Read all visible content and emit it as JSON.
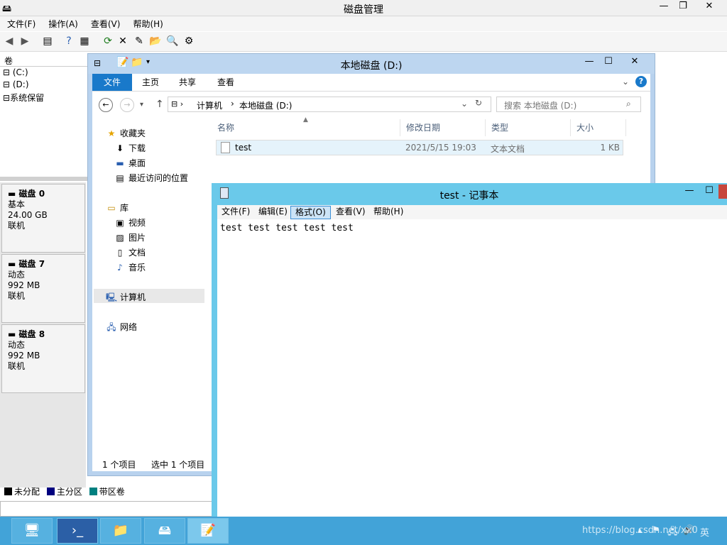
{
  "disk_management": {
    "title": "磁盘管理",
    "menu": [
      "文件(F)",
      "操作(A)",
      "查看(V)",
      "帮助(H)"
    ],
    "volume_column": "卷",
    "volumes": [
      "(C:)",
      "(D:)",
      "系统保留"
    ],
    "disks": [
      {
        "name": "磁盘 0",
        "type": "基本",
        "size": "24.00 GB",
        "status": "联机"
      },
      {
        "name": "磁盘 7",
        "type": "动态",
        "size": "992 MB",
        "status": "联机"
      },
      {
        "name": "磁盘 8",
        "type": "动态",
        "size": "992 MB",
        "status": "联机"
      }
    ],
    "legend": [
      {
        "label": "未分配",
        "color": "#000000"
      },
      {
        "label": "主分区",
        "color": "#00007f"
      },
      {
        "label": "带区卷",
        "color": "#008080"
      }
    ]
  },
  "explorer": {
    "title": "本地磁盘 (D:)",
    "ribbon_tabs": [
      "文件",
      "主页",
      "共享",
      "查看"
    ],
    "address": [
      "计算机",
      "本地磁盘 (D:)"
    ],
    "search_placeholder": "搜索 本地磁盘 (D:)",
    "nav": {
      "favorites": "收藏夹",
      "downloads": "下载",
      "desktop": "桌面",
      "recent": "最近访问的位置",
      "libraries": "库",
      "videos": "视频",
      "pictures": "图片",
      "documents": "文档",
      "music": "音乐",
      "computer": "计算机",
      "network": "网络"
    },
    "columns": [
      "名称",
      "修改日期",
      "类型",
      "大小"
    ],
    "file": {
      "name": "test",
      "modified": "2021/5/15 19:03",
      "type": "文本文档",
      "size": "1 KB"
    },
    "status_count": "1 个项目",
    "status_selected": "选中 1 个项目"
  },
  "notepad": {
    "title": "test - 记事本",
    "menu": [
      "文件(F)",
      "编辑(E)",
      "格式(O)",
      "查看(V)",
      "帮助(H)"
    ],
    "content": "test test test test test"
  },
  "taskbar": {
    "watermark": "https://blog.csdn.net/xx0"
  },
  "colors": {
    "accent": "#1979ca",
    "taskbar": "#42a3d8",
    "notepad_frame": "#6ac9ea"
  }
}
